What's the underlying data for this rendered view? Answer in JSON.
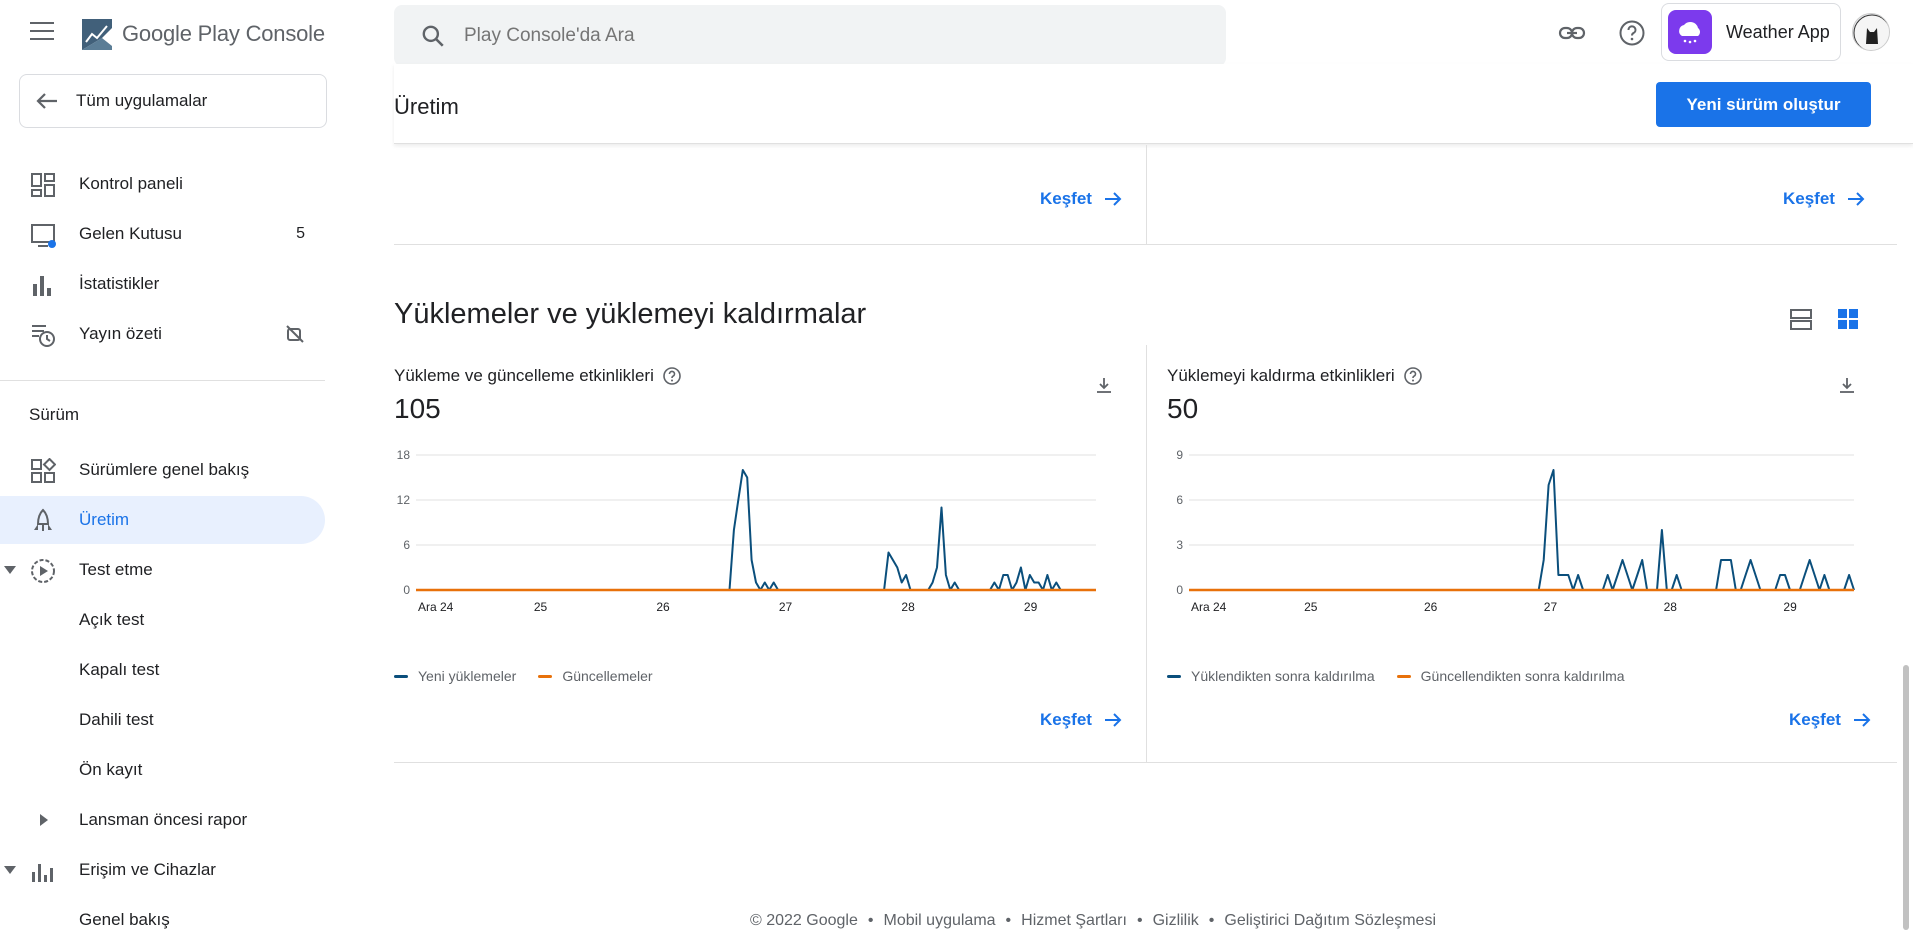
{
  "topbar": {
    "logo_text": "Google Play",
    "logo_console": "Console",
    "search_placeholder": "Play Console'da Ara",
    "app_name": "Weather App"
  },
  "sidebar": {
    "back_label": "Tüm uygulamalar",
    "items": [
      {
        "label": "Kontrol paneli"
      },
      {
        "label": "Gelen Kutusu",
        "badge": "5"
      },
      {
        "label": "İstatistikler"
      },
      {
        "label": "Yayın özeti"
      }
    ],
    "section_title": "Sürüm",
    "release_items": [
      {
        "label": "Sürümlere genel bakış"
      },
      {
        "label": "Üretim"
      },
      {
        "label": "Test etme"
      },
      {
        "label": "Açık test"
      },
      {
        "label": "Kapalı test"
      },
      {
        "label": "Dahili test"
      },
      {
        "label": "Ön kayıt"
      },
      {
        "label": "Lansman öncesi rapor"
      },
      {
        "label": "Erişim ve Cihazlar"
      },
      {
        "label": "Genel bakış"
      }
    ]
  },
  "main": {
    "page_title": "Üretim",
    "new_release_label": "Yeni sürüm oluştur",
    "explore_label": "Keşfet",
    "section_title": "Yüklemeler ve yüklemeyi kaldırmalar",
    "cards": [
      {
        "title": "Yükleme ve güncelleme etkinlikleri",
        "value": "105",
        "legend": [
          "Yeni yüklemeler",
          "Güncellemeler"
        ]
      },
      {
        "title": "Yüklemeyi kaldırma etkinlikleri",
        "value": "50",
        "legend": [
          "Yüklendikten sonra kaldırılma",
          "Güncellendikten sonra kaldırılma"
        ]
      }
    ]
  },
  "footer": {
    "items": [
      "© 2022 Google",
      "Mobil uygulama",
      "Hizmet Şartları",
      "Gizlilik",
      "Geliştirici Dağıtım Sözleşmesi"
    ]
  },
  "colors": {
    "primary": "#1a73e8",
    "series_blue": "#0b4f7c",
    "series_orange": "#e8710a"
  },
  "chart_data": [
    {
      "type": "line",
      "x_tick_labels": [
        "Ara 24",
        "25",
        "26",
        "27",
        "28",
        "29"
      ],
      "ylim": [
        0,
        18
      ],
      "y_ticks": [
        0,
        6,
        12,
        18
      ],
      "grid": true,
      "legend_position": "bottom-left",
      "series": [
        {
          "name": "Yeni yüklemeler",
          "color": "#0b4f7c",
          "values": [
            0,
            0,
            0,
            0,
            0,
            0,
            0,
            0,
            0,
            0,
            0,
            0,
            0,
            0,
            0,
            0,
            0,
            0,
            0,
            0,
            0,
            0,
            0,
            0,
            0,
            0,
            0,
            0,
            0,
            0,
            0,
            0,
            0,
            0,
            0,
            0,
            0,
            0,
            0,
            0,
            0,
            0,
            0,
            0,
            0,
            0,
            0,
            0,
            0,
            0,
            0,
            0,
            0,
            0,
            0,
            0,
            0,
            0,
            0,
            0,
            0,
            0,
            0,
            0,
            0,
            0,
            0,
            0,
            0,
            0,
            0,
            0,
            8,
            12,
            16,
            15,
            4,
            1,
            0,
            1,
            0,
            1,
            0,
            0,
            0,
            0,
            0,
            0,
            0,
            0,
            0,
            0,
            0,
            0,
            0,
            0,
            0,
            0,
            0,
            0,
            0,
            0,
            0,
            0,
            0,
            0,
            0,
            5,
            4,
            3,
            1,
            2,
            0,
            0,
            0,
            0,
            0,
            1,
            3,
            11,
            2,
            0,
            1,
            0,
            0,
            0,
            0,
            0,
            0,
            0,
            0,
            1,
            0,
            2,
            2,
            0,
            1,
            3,
            0,
            2,
            1,
            1,
            0,
            2,
            0,
            1,
            0,
            0,
            0,
            0,
            0,
            0,
            0,
            0,
            0
          ]
        },
        {
          "name": "Güncellemeler",
          "color": "#e8710a",
          "values": [
            0,
            0,
            0,
            0,
            0,
            0,
            0,
            0,
            0,
            0,
            0,
            0,
            0,
            0,
            0,
            0,
            0,
            0,
            0,
            0,
            0,
            0,
            0,
            0,
            0,
            0,
            0,
            0,
            0,
            0,
            0,
            0,
            0,
            0,
            0,
            0,
            0,
            0,
            0,
            0,
            0,
            0,
            0,
            0,
            0,
            0,
            0,
            0,
            0,
            0,
            0,
            0,
            0,
            0,
            0,
            0,
            0,
            0,
            0,
            0,
            0,
            0,
            0,
            0,
            0,
            0,
            0,
            0,
            0,
            0,
            0,
            0,
            0,
            0,
            0,
            0,
            0,
            0,
            0,
            0,
            0,
            0,
            0,
            0,
            0,
            0,
            0,
            0,
            0,
            0,
            0,
            0,
            0,
            0,
            0,
            0,
            0,
            0,
            0,
            0,
            0,
            0,
            0,
            0,
            0,
            0,
            0,
            0,
            0,
            0,
            0,
            0,
            0,
            0,
            0,
            0,
            0,
            0,
            0,
            0,
            0,
            0,
            0,
            0,
            0,
            0,
            0,
            0,
            0,
            0,
            0,
            0,
            0,
            0,
            0,
            0,
            0,
            0,
            0,
            0,
            0,
            0,
            0,
            0,
            0,
            0,
            0,
            0,
            0,
            0,
            0,
            0,
            0,
            0,
            0
          ]
        }
      ]
    },
    {
      "type": "line",
      "x_tick_labels": [
        "Ara 24",
        "25",
        "26",
        "27",
        "28",
        "29"
      ],
      "ylim": [
        0,
        9
      ],
      "y_ticks": [
        0,
        3,
        6,
        9
      ],
      "grid": true,
      "legend_position": "bottom-left",
      "series": [
        {
          "name": "Yüklendikten sonra kaldırılma",
          "color": "#0b4f7c",
          "values": [
            0,
            0,
            0,
            0,
            0,
            0,
            0,
            0,
            0,
            0,
            0,
            0,
            0,
            0,
            0,
            0,
            0,
            0,
            0,
            0,
            0,
            0,
            0,
            0,
            0,
            0,
            0,
            0,
            0,
            0,
            0,
            0,
            0,
            0,
            0,
            0,
            0,
            0,
            0,
            0,
            0,
            0,
            0,
            0,
            0,
            0,
            0,
            0,
            0,
            0,
            0,
            0,
            0,
            0,
            0,
            0,
            0,
            0,
            0,
            0,
            0,
            0,
            0,
            0,
            0,
            0,
            0,
            0,
            0,
            0,
            0,
            0,
            2,
            7,
            8,
            1,
            1,
            1,
            0,
            1,
            0,
            0,
            0,
            0,
            0,
            1,
            0,
            1,
            2,
            1,
            0,
            1,
            2,
            0,
            0,
            0,
            4,
            0,
            0,
            1,
            0,
            0,
            0,
            0,
            0,
            0,
            0,
            0,
            2,
            2,
            2,
            0,
            0,
            1,
            2,
            1,
            0,
            0,
            0,
            0,
            1,
            1,
            0,
            0,
            0,
            1,
            2,
            1,
            0,
            1,
            0,
            0,
            0,
            0,
            1,
            0
          ]
        },
        {
          "name": "Güncellendikten sonra kaldırılma",
          "color": "#e8710a",
          "values": [
            0,
            0,
            0,
            0,
            0,
            0,
            0,
            0,
            0,
            0,
            0,
            0,
            0,
            0,
            0,
            0,
            0,
            0,
            0,
            0,
            0,
            0,
            0,
            0,
            0,
            0,
            0,
            0,
            0,
            0,
            0,
            0,
            0,
            0,
            0,
            0,
            0,
            0,
            0,
            0,
            0,
            0,
            0,
            0,
            0,
            0,
            0,
            0,
            0,
            0,
            0,
            0,
            0,
            0,
            0,
            0,
            0,
            0,
            0,
            0,
            0,
            0,
            0,
            0,
            0,
            0,
            0,
            0,
            0,
            0,
            0,
            0,
            0,
            0,
            0,
            0,
            0,
            0,
            0,
            0,
            0,
            0,
            0,
            0,
            0,
            0,
            0,
            0,
            0,
            0,
            0,
            0,
            0,
            0,
            0,
            0,
            0,
            0,
            0,
            0,
            0,
            0,
            0,
            0,
            0,
            0,
            0,
            0,
            0,
            0,
            0,
            0,
            0,
            0,
            0,
            0,
            0,
            0,
            0,
            0,
            0,
            0,
            0,
            0,
            0,
            0,
            0,
            0,
            0,
            0,
            0,
            0,
            0,
            0,
            0,
            0,
            0
          ]
        }
      ]
    }
  ]
}
